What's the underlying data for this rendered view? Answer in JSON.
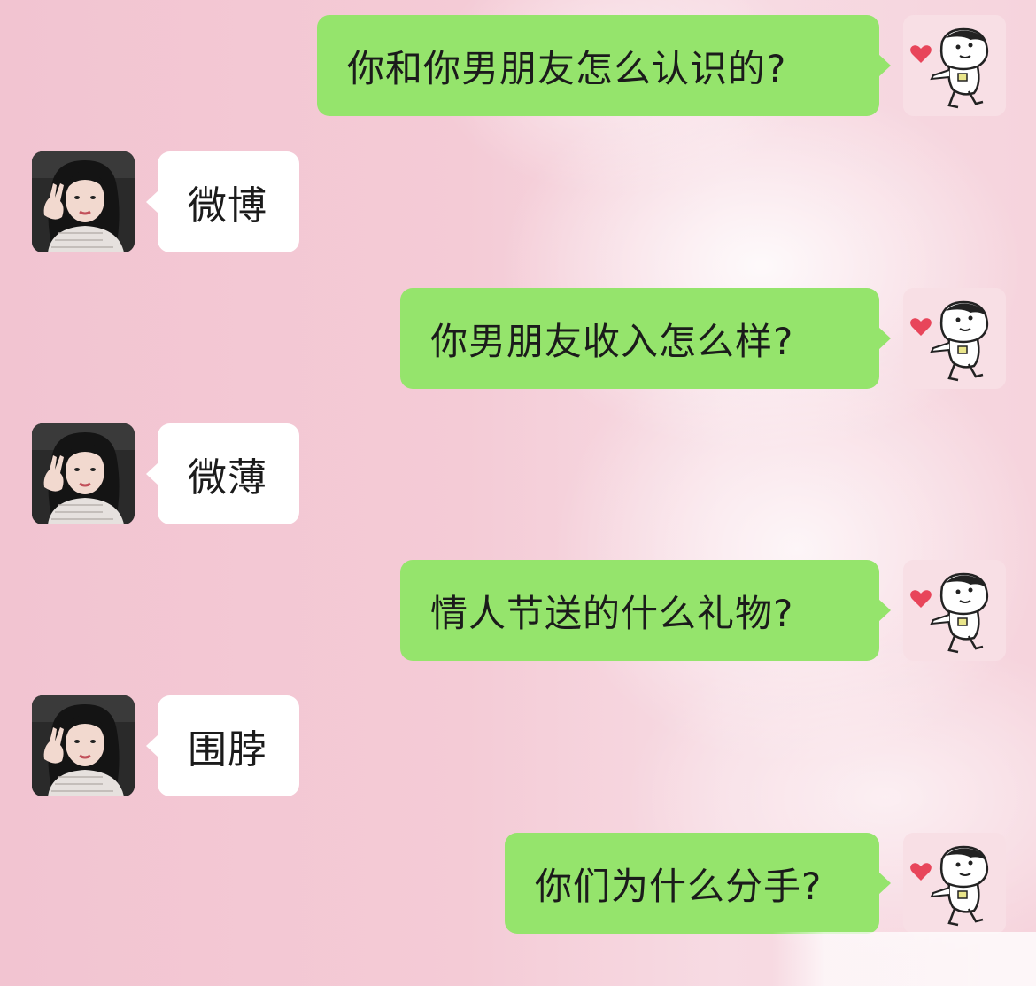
{
  "colors": {
    "outgoing_bubble": "#95e46c",
    "incoming_bubble": "#ffffff",
    "background_pink": "#f2c4d1",
    "text": "#1b1b1b",
    "heart": "#e8455a"
  },
  "avatars": {
    "self": "cartoon-boy-with-heart-icon",
    "contact": "girl-peace-sign-photo-avatar"
  },
  "messages": [
    {
      "side": "right",
      "text": "你和你男朋友怎么认识的?"
    },
    {
      "side": "left",
      "text": "微博"
    },
    {
      "side": "right",
      "text": "你男朋友收入怎么样?"
    },
    {
      "side": "left",
      "text": "微薄"
    },
    {
      "side": "right",
      "text": "情人节送的什么礼物?"
    },
    {
      "side": "left",
      "text": "围脖"
    },
    {
      "side": "right",
      "text": "你们为什么分手?"
    }
  ]
}
